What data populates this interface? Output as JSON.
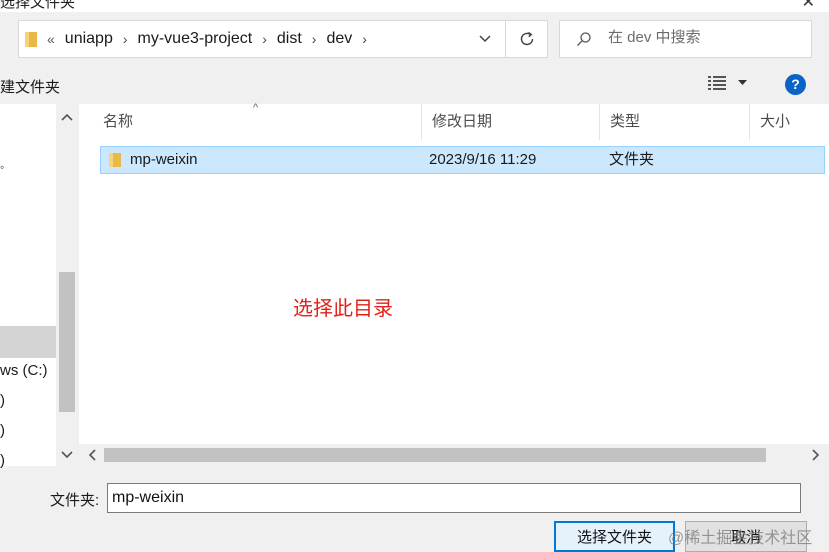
{
  "window": {
    "title": "选择文件夹",
    "close_glyph": "✕"
  },
  "address_bar": {
    "lead": "«",
    "crumbs": [
      "uniapp",
      "my-vue3-project",
      "dist",
      "dev"
    ],
    "separator": "›"
  },
  "search": {
    "placeholder": "在 dev 中搜索"
  },
  "toolbar": {
    "new_folder": "建文件夹",
    "help": "?"
  },
  "nav_pane": {
    "items": [
      "ws (C:)",
      ")",
      ")",
      ")"
    ]
  },
  "columns": {
    "name": "名称",
    "modified": "修改日期",
    "type": "类型",
    "size": "大小"
  },
  "files": [
    {
      "name": "mp-weixin",
      "modified": "2023/9/16 11:29",
      "type": "文件夹"
    }
  ],
  "annotation": "选择此目录",
  "footer": {
    "folder_label": "文件夹:",
    "folder_value": "mp-weixin",
    "select_button": "选择文件夹",
    "cancel_button": "取消",
    "watermark": "@稀土掘金技术社区"
  },
  "colors": {
    "selection": "#cce8ff",
    "accent": "#0078d7",
    "annotation": "#e3211a"
  },
  "icons": [
    "folder-icon",
    "chevron-down-icon",
    "refresh-icon",
    "search-icon",
    "view-menu-icon",
    "help-icon"
  ]
}
